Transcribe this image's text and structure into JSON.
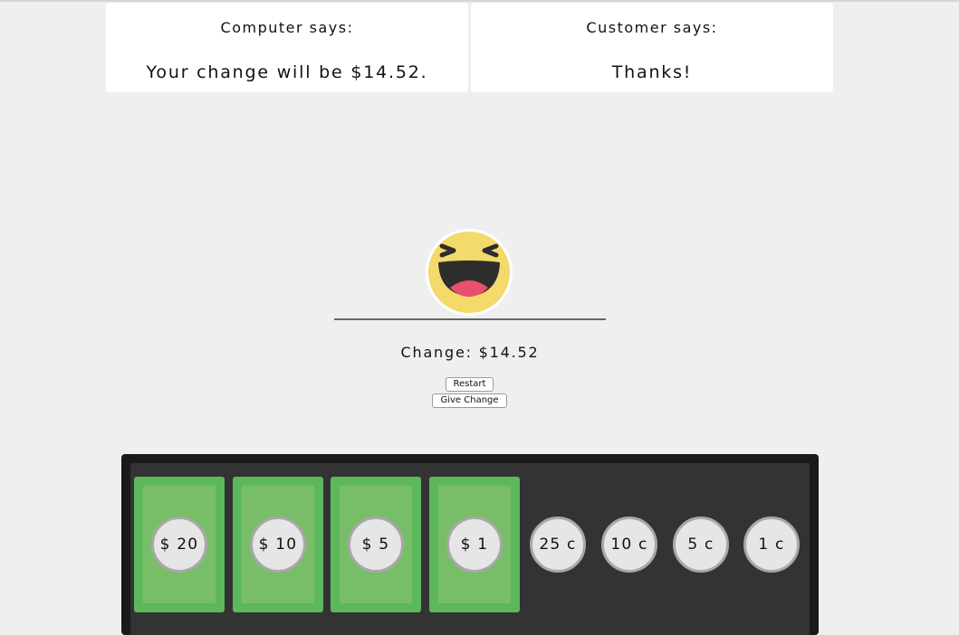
{
  "computer": {
    "label": "Computer says:",
    "message": "Your change will be $14.52."
  },
  "customer": {
    "label": "Customer says:",
    "message": "Thanks!"
  },
  "status": {
    "change": "Change: $14.52",
    "mood": "laughing"
  },
  "buttons": {
    "restart": "Restart",
    "give_change": "Give Change"
  },
  "bills": [
    {
      "label": "$ 20"
    },
    {
      "label": "$ 10"
    },
    {
      "label": "$ 5"
    },
    {
      "label": "$ 1"
    }
  ],
  "coins": [
    {
      "label": "25 c"
    },
    {
      "label": "10 c"
    },
    {
      "label": "5 c"
    },
    {
      "label": "1 c"
    }
  ],
  "colors": {
    "background": "#efefef",
    "bill": "#5db85c",
    "bill_inner": "#78be68",
    "tray": "#333333",
    "emoji_face": "#f4d96b",
    "emoji_tongue": "#e8506e"
  }
}
